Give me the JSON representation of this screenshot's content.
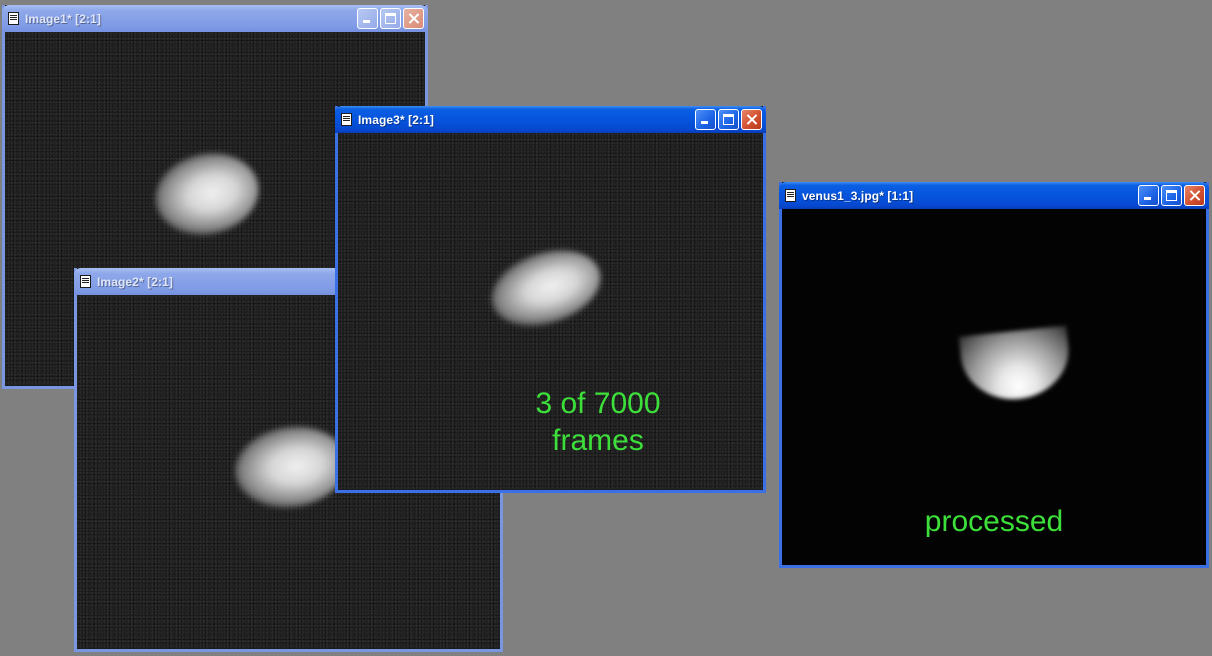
{
  "desktop": {
    "background_color": "#808080"
  },
  "windows": {
    "image1": {
      "title": "Image1* [2:1]"
    },
    "image2": {
      "title": "Image2* [2:1]"
    },
    "image3": {
      "title": "Image3* [2:1]",
      "caption_line1": "3 of 7000",
      "caption_line2": "frames"
    },
    "venus": {
      "title": "venus1_3.jpg* [1:1]",
      "caption": "processed"
    }
  },
  "icons": {
    "document": "document-icon",
    "minimize": "minimize-icon",
    "maximize": "maximize-icon",
    "close": "close-icon"
  },
  "colors": {
    "active_titlebar": "#0653dc",
    "inactive_titlebar": "#7f9be6",
    "caption_text": "#3de03a",
    "close_button": "#d2502f"
  }
}
